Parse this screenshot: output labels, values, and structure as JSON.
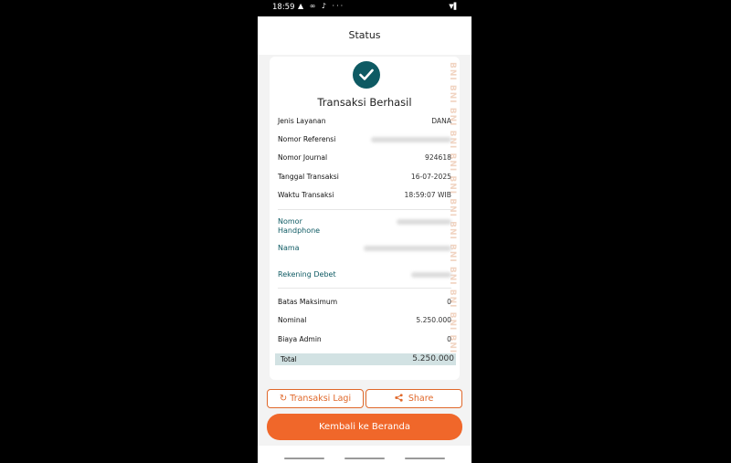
{
  "status_bar": {
    "time": "18:59",
    "icons": "▲ ∞ ♪ ···",
    "right_icons": "▼▌"
  },
  "header": {
    "title": "Status"
  },
  "receipt": {
    "title": "Transaksi Berhasil",
    "watermark": "BNI BNI BNI BNI BNI BNI BNI BNI BNI BNI BNI BNI BNI",
    "rows": [
      {
        "label": "Jenis Layanan",
        "value": "DANA"
      },
      {
        "label": "Nomor Referensi",
        "value": ""
      },
      {
        "label": "Nomor Journal",
        "value": "924618"
      },
      {
        "label": "Tanggal Transaksi",
        "value": "16-07-2025"
      },
      {
        "label": "Waktu Transaksi",
        "value": "18:59:07 WIB"
      }
    ],
    "customer": {
      "phone_label": "Nomor\nHandphone",
      "name_label": "Nama",
      "account_label": "Rekening Debet"
    },
    "amounts": [
      {
        "label": "Batas Maksimum",
        "value": "0"
      },
      {
        "label": "Nominal",
        "value": "5.250.000"
      },
      {
        "label": "Biaya Admin",
        "value": "0"
      }
    ],
    "total": {
      "label": "Total",
      "value": "5.250.000"
    }
  },
  "actions": {
    "again_label": "Transaksi Lagi",
    "share_label": "Share",
    "home_label": "Kembali ke Beranda"
  },
  "colors": {
    "accent": "#f0672a",
    "teal": "#0e5a63"
  }
}
